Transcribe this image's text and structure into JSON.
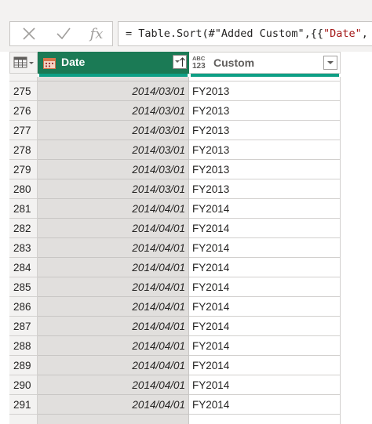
{
  "formula_bar": {
    "cancel_icon": "close-icon",
    "confirm_icon": "check-icon",
    "fx_label": "fx",
    "formula_prefix": "= Table.Sort(#\"Added Custom\",{{",
    "formula_string": "\"Date\"",
    "formula_suffix": ", C"
  },
  "grid": {
    "table_menu_icon": "table-icon",
    "columns": [
      {
        "name": "Date",
        "type_icon": "calendar-icon",
        "sort_icon": "sort-ascending-icon"
      },
      {
        "name": "Custom",
        "type_abc": "ABC",
        "type_123": "123",
        "filter_icon": "chevron-down-icon"
      }
    ],
    "rows": [
      {
        "num": "275",
        "date": "2014/03/01",
        "custom": "FY2013"
      },
      {
        "num": "276",
        "date": "2014/03/01",
        "custom": "FY2013"
      },
      {
        "num": "277",
        "date": "2014/03/01",
        "custom": "FY2013"
      },
      {
        "num": "278",
        "date": "2014/03/01",
        "custom": "FY2013"
      },
      {
        "num": "279",
        "date": "2014/03/01",
        "custom": "FY2013"
      },
      {
        "num": "280",
        "date": "2014/03/01",
        "custom": "FY2013"
      },
      {
        "num": "281",
        "date": "2014/04/01",
        "custom": "FY2014"
      },
      {
        "num": "282",
        "date": "2014/04/01",
        "custom": "FY2014"
      },
      {
        "num": "283",
        "date": "2014/04/01",
        "custom": "FY2014"
      },
      {
        "num": "284",
        "date": "2014/04/01",
        "custom": "FY2014"
      },
      {
        "num": "285",
        "date": "2014/04/01",
        "custom": "FY2014"
      },
      {
        "num": "286",
        "date": "2014/04/01",
        "custom": "FY2014"
      },
      {
        "num": "287",
        "date": "2014/04/01",
        "custom": "FY2014"
      },
      {
        "num": "288",
        "date": "2014/04/01",
        "custom": "FY2014"
      },
      {
        "num": "289",
        "date": "2014/04/01",
        "custom": "FY2014"
      },
      {
        "num": "290",
        "date": "2014/04/01",
        "custom": "FY2014"
      },
      {
        "num": "291",
        "date": "2014/04/01",
        "custom": "FY2014"
      }
    ]
  },
  "colors": {
    "selected_header": "#1b7a55",
    "quality_bar": "#0e9f85",
    "selected_column": "#e1dfdd"
  }
}
